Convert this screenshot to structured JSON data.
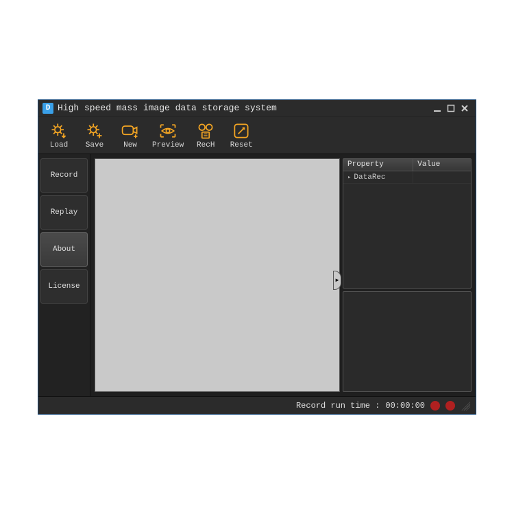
{
  "window": {
    "title": "High speed mass image data storage system"
  },
  "toolbar": {
    "load": "Load",
    "save": "Save",
    "new": "New",
    "preview": "Preview",
    "rech": "RecH",
    "reset": "Reset"
  },
  "sidebar": {
    "items": [
      {
        "label": "Record"
      },
      {
        "label": "Replay"
      },
      {
        "label": "About"
      },
      {
        "label": "License"
      }
    ]
  },
  "propgrid": {
    "col_property": "Property",
    "col_value": "Value",
    "rows": [
      {
        "name": "DataRec",
        "value": ""
      }
    ]
  },
  "status": {
    "label": "Record run time :",
    "time": "00:00:00"
  },
  "colors": {
    "accent": "#f5a623",
    "bg": "#2b2b2b",
    "record_dot": "#b02020"
  }
}
